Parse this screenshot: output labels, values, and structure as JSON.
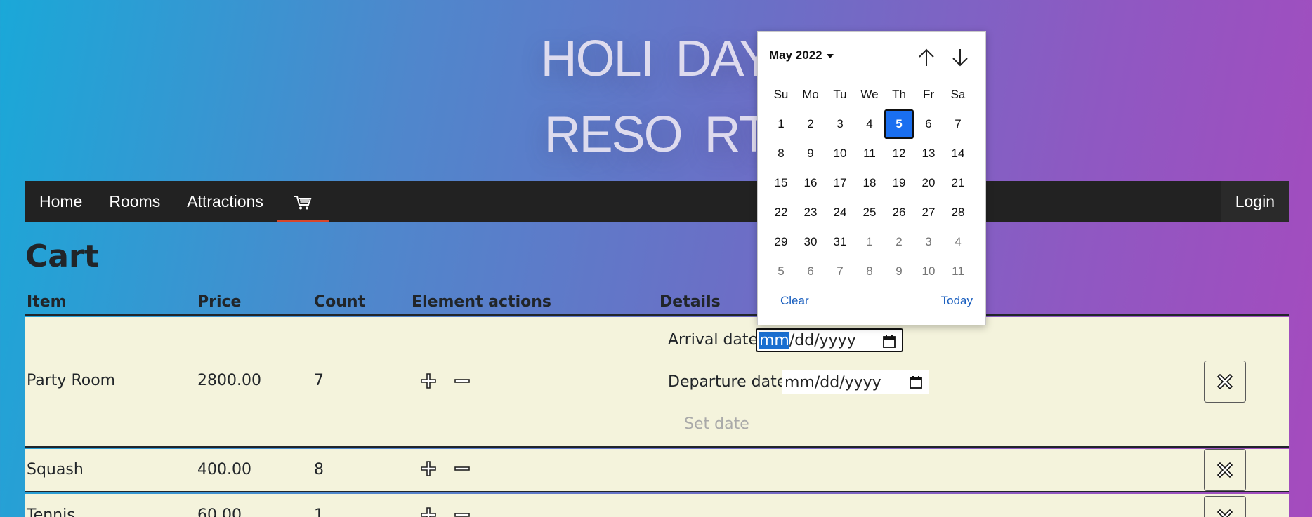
{
  "hero": {
    "line1": "HOLI DAY",
    "line2": "RESO  RT"
  },
  "nav": {
    "items": [
      "Home",
      "Rooms",
      "Attractions"
    ],
    "cart_icon": "cart-icon",
    "login": "Login"
  },
  "page": {
    "heading": "Cart"
  },
  "table": {
    "headers": {
      "item": "Item",
      "price": "Price",
      "count": "Count",
      "actions": "Element actions",
      "details": "Details"
    },
    "rows": [
      {
        "item": "Party Room",
        "price": "2800.00",
        "count": "7"
      },
      {
        "item": "Squash",
        "price": "400.00",
        "count": "8"
      },
      {
        "item": "Tennis",
        "price": "60.00",
        "count": "1"
      }
    ]
  },
  "details": {
    "arrival_label": "Arrival date",
    "arrival_value_highlight": "mm",
    "arrival_value_rest": "/dd/yyyy",
    "departure_label": "Departure date",
    "departure_value": "mm/dd/yyyy",
    "set_date": "Set date"
  },
  "picker": {
    "month": "May 2022",
    "weekdays": [
      "Su",
      "Mo",
      "Tu",
      "We",
      "Th",
      "Fr",
      "Sa"
    ],
    "weeks": [
      [
        "1",
        "2",
        "3",
        "4",
        "5",
        "6",
        "7"
      ],
      [
        "8",
        "9",
        "10",
        "11",
        "12",
        "13",
        "14"
      ],
      [
        "15",
        "16",
        "17",
        "18",
        "19",
        "20",
        "21"
      ],
      [
        "22",
        "23",
        "24",
        "25",
        "26",
        "27",
        "28"
      ],
      [
        "29",
        "30",
        "31",
        "1",
        "2",
        "3",
        "4"
      ],
      [
        "5",
        "6",
        "7",
        "8",
        "9",
        "10",
        "11"
      ]
    ],
    "selected": "5",
    "clear": "Clear",
    "today": "Today"
  },
  "colors": {
    "navbar": "#222222",
    "row_bg": "#f4f3dc",
    "accent": "#1a6ff0",
    "cart_underline": "#d8462a"
  }
}
